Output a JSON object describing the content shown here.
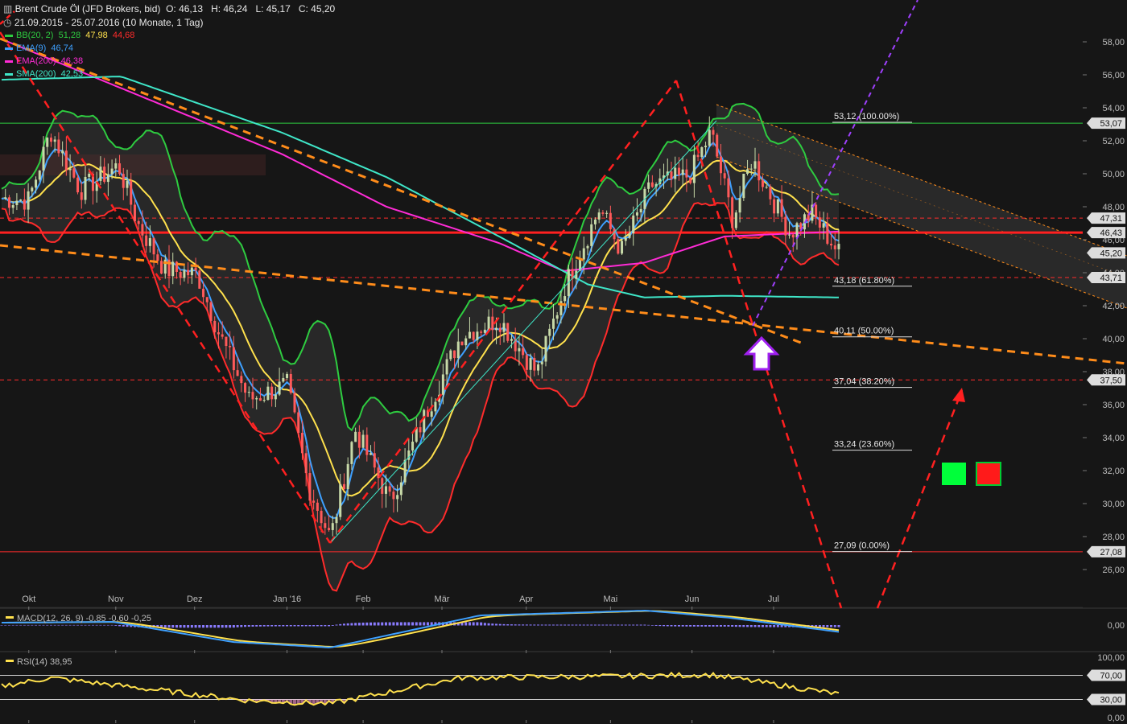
{
  "header": {
    "title": "Brent Crude Öl (JFD Brokers, bid)",
    "ohlc": "O: 46,13   H: 46,24   L: 45,17   C: 45,20",
    "range": "21.09.2015 - 25.07.2016 (10 Monate, 1 Tag)"
  },
  "legend": [
    {
      "label": "BB(20, 2)",
      "values": [
        "51,28",
        "47,98",
        "44,68"
      ],
      "colors": [
        "#2ecc40",
        "#ffe14d",
        "#ff2b2b"
      ]
    },
    {
      "label": "EMA(9)",
      "values": [
        "46,74"
      ],
      "colors": [
        "#3ea0ff"
      ]
    },
    {
      "label": "EMA(200)",
      "values": [
        "46,38"
      ],
      "colors": [
        "#ff2bd6"
      ]
    },
    {
      "label": "SMA(200)",
      "values": [
        "42,53"
      ],
      "colors": [
        "#3fe6c8"
      ]
    }
  ],
  "colors": {
    "background": "#161616",
    "candle_up": "#c7d9a8",
    "candle_down": "#ff5a5a",
    "bb_upper": "#2ecc40",
    "bb_mid": "#ffe14d",
    "bb_lower": "#ff2b2b",
    "ema9": "#3ea0ff",
    "ema200": "#ff2bd6",
    "sma200": "#3fe6c8",
    "trend_orange": "#ff8c1a",
    "trend_red": "#ff2020",
    "trend_purple": "#a040ff",
    "channel": "#ff8c1a",
    "macd_line": "#3ea0ff",
    "macd_signal": "#ffe14d",
    "macd_hist": "#8a7bff",
    "rsi": "#ffe14d",
    "green_box": "#00ff3a",
    "red_box": "#ff1a1a"
  },
  "chart_data": [
    {
      "type": "candlestick",
      "title": "Brent Crude Öl (JFD Brokers, bid)",
      "x_ticks": [
        "Okt",
        "Nov",
        "Dez",
        "Jan '16",
        "Feb",
        "Mär",
        "Apr",
        "Mai",
        "Jun",
        "Jul"
      ],
      "y_ticks": [
        "26,00",
        "28,00",
        "30,00",
        "32,00",
        "34,00",
        "36,00",
        "38,00",
        "40,00",
        "42,00",
        "44,00",
        "46,00",
        "48,00",
        "50,00",
        "52,00",
        "54,00",
        "56,00",
        "58,00"
      ],
      "ylim": [
        25,
        58.5
      ],
      "price_series_approx": [
        {
          "date": "2015-09-21",
          "close": 48.5
        },
        {
          "date": "2015-10-01",
          "close": 48.4
        },
        {
          "date": "2015-10-09",
          "close": 52.6
        },
        {
          "date": "2015-10-20",
          "close": 49.0
        },
        {
          "date": "2015-11-03",
          "close": 50.5
        },
        {
          "date": "2015-11-10",
          "close": 47.0
        },
        {
          "date": "2015-11-20",
          "close": 44.2
        },
        {
          "date": "2015-12-02",
          "close": 43.9
        },
        {
          "date": "2015-12-10",
          "close": 40.3
        },
        {
          "date": "2015-12-21",
          "close": 36.3
        },
        {
          "date": "2016-01-04",
          "close": 37.2
        },
        {
          "date": "2016-01-12",
          "close": 31.0
        },
        {
          "date": "2016-01-20",
          "close": 27.9
        },
        {
          "date": "2016-01-29",
          "close": 34.5
        },
        {
          "date": "2016-02-11",
          "close": 30.1
        },
        {
          "date": "2016-02-22",
          "close": 34.7
        },
        {
          "date": "2016-03-08",
          "close": 40.2
        },
        {
          "date": "2016-03-22",
          "close": 41.2
        },
        {
          "date": "2016-04-05",
          "close": 37.9
        },
        {
          "date": "2016-04-15",
          "close": 43.1
        },
        {
          "date": "2016-04-28",
          "close": 47.9
        },
        {
          "date": "2016-05-06",
          "close": 45.3
        },
        {
          "date": "2016-05-17",
          "close": 49.3
        },
        {
          "date": "2016-05-31",
          "close": 49.9
        },
        {
          "date": "2016-06-08",
          "close": 52.5
        },
        {
          "date": "2016-06-16",
          "close": 47.2
        },
        {
          "date": "2016-06-23",
          "close": 50.9
        },
        {
          "date": "2016-07-07",
          "close": 46.4
        },
        {
          "date": "2016-07-15",
          "close": 47.6
        },
        {
          "date": "2016-07-25",
          "close": 45.2
        }
      ],
      "fibonacci": [
        {
          "label": "53,12 (100.00%)",
          "value": 53.12
        },
        {
          "label": "43,18 (61.80%)",
          "value": 43.18
        },
        {
          "label": "40,11 (50.00%)",
          "value": 40.11
        },
        {
          "label": "37,04 (38.20%)",
          "value": 37.04
        },
        {
          "label": "33,24 (23.60%)",
          "value": 33.24
        },
        {
          "label": "27,09 (0.00%)",
          "value": 27.09
        }
      ],
      "level_badges": [
        {
          "label": "53,07",
          "value": 53.07,
          "color": "#dddddd"
        },
        {
          "label": "47,31",
          "value": 47.31,
          "color": "#dddddd"
        },
        {
          "label": "46,43",
          "value": 46.43,
          "color": "#dddddd"
        },
        {
          "label": "45,20",
          "value": 45.2,
          "color": "#dddddd"
        },
        {
          "label": "43,71",
          "value": 43.71,
          "color": "#dddddd"
        },
        {
          "label": "37,50",
          "value": 37.5,
          "color": "#dddddd"
        },
        {
          "label": "27,08",
          "value": 27.08,
          "color": "#dddddd"
        }
      ]
    },
    {
      "type": "line",
      "title": "MACD(12, 26, 9)",
      "values_text": [
        "-0,85",
        "-0,60",
        "-0,25"
      ],
      "y_ticks": [
        "0,00"
      ],
      "series_approx": [
        {
          "date": "2015-09-21",
          "macd": 0.3
        },
        {
          "date": "2015-11-01",
          "macd": 0.4
        },
        {
          "date": "2015-12-15",
          "macd": -2.1
        },
        {
          "date": "2016-01-20",
          "macd": -2.8
        },
        {
          "date": "2016-03-15",
          "macd": 1.2
        },
        {
          "date": "2016-05-15",
          "macd": 1.8
        },
        {
          "date": "2016-06-15",
          "macd": 0.9
        },
        {
          "date": "2016-07-25",
          "macd": -0.85
        }
      ]
    },
    {
      "type": "line",
      "title": "RSI(14)",
      "value_text": "38,95",
      "y_ticks": [
        "0,00",
        "30,00",
        "70,00",
        "100,00"
      ],
      "ylim": [
        0,
        100
      ],
      "series_approx": [
        {
          "date": "2015-09-21",
          "rsi": 52
        },
        {
          "date": "2015-10-09",
          "rsi": 66
        },
        {
          "date": "2015-12-21",
          "rsi": 28
        },
        {
          "date": "2016-01-20",
          "rsi": 23
        },
        {
          "date": "2016-03-08",
          "rsi": 66
        },
        {
          "date": "2016-04-28",
          "rsi": 68
        },
        {
          "date": "2016-06-08",
          "rsi": 71
        },
        {
          "date": "2016-07-25",
          "rsi": 38.95
        }
      ]
    }
  ]
}
